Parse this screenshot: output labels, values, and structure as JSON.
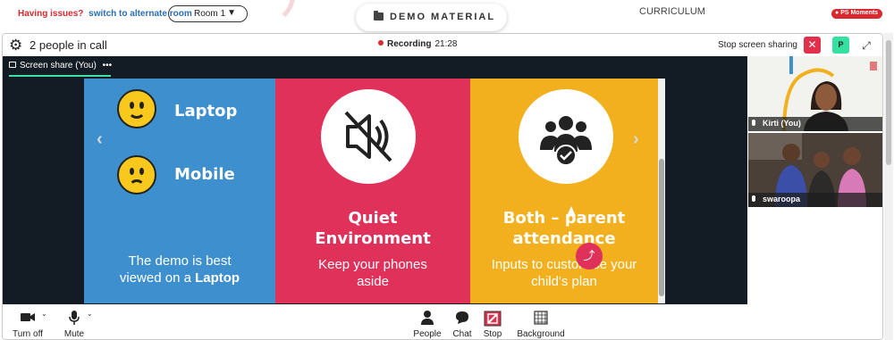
{
  "topbar": {
    "issue_text": "Having issues?",
    "issue_link": "switch to alternate room",
    "room_value": "Room 1",
    "demo_label": "DEMO MATERIAL",
    "curriculum_label": "CURRICULUM",
    "moments_label": "PS Moments"
  },
  "call": {
    "people_count": "2 people in call",
    "recording_label": "Recording",
    "recording_time": "21:28",
    "stop_share_label": "Stop screen sharing",
    "avatar_initial": "P",
    "share_tab_label": "Screen share (You)"
  },
  "slide": {
    "option_laptop": "Laptop",
    "option_mobile": "Mobile",
    "caption1_line1": "The demo is best",
    "caption1_line2": "viewed on a",
    "caption1_bold": "Laptop",
    "head2_line1": "Quiet",
    "head2_line2": "Environment",
    "caption2_line1": "Keep your phones",
    "caption2_line2": "aside",
    "head3_line1": "Both – parent",
    "head3_line2": "attendance",
    "caption3_line1": "Inputs to customise your",
    "caption3_line2": "child's plan"
  },
  "participants": [
    {
      "name": "Kirti (You)"
    },
    {
      "name": "swaroopa"
    }
  ],
  "controls": {
    "camera": "Turn off",
    "mic": "Mute",
    "people": "People",
    "chat": "Chat",
    "stop": "Stop",
    "background": "Background"
  },
  "colors": {
    "accent_green": "#3fe0a8",
    "record_red": "#d9282f",
    "panel_blue": "#3e8fce",
    "panel_pink": "#e0315a",
    "panel_yellow": "#f2b01e"
  }
}
